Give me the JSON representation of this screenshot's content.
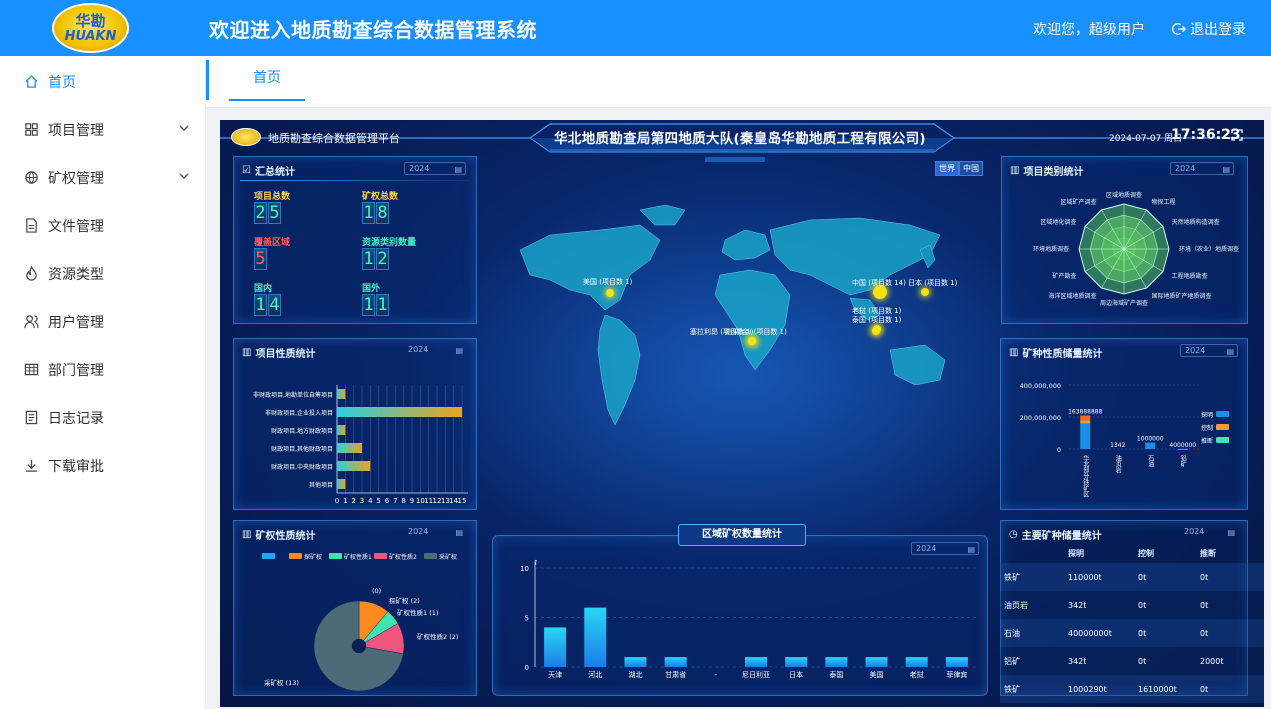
{
  "header": {
    "logo_cn": "华勘",
    "logo_en": "HUAKN",
    "title": "欢迎进入地质勘查综合数据管理系统",
    "welcome": "欢迎您，超级用户",
    "logout": "退出登录"
  },
  "sidebar": {
    "items": [
      {
        "label": "首页",
        "icon": "home-icon",
        "active": true
      },
      {
        "label": "项目管理",
        "icon": "grid-icon",
        "expandable": true
      },
      {
        "label": "矿权管理",
        "icon": "globe-icon",
        "expandable": true
      },
      {
        "label": "文件管理",
        "icon": "file-icon"
      },
      {
        "label": "资源类型",
        "icon": "fire-icon"
      },
      {
        "label": "用户管理",
        "icon": "users-icon"
      },
      {
        "label": "部门管理",
        "icon": "table-icon"
      },
      {
        "label": "日志记录",
        "icon": "log-icon"
      },
      {
        "label": "下载审批",
        "icon": "download-icon"
      }
    ]
  },
  "tabs": [
    {
      "label": "首页"
    }
  ],
  "dashboard": {
    "platform": "地质勘查综合数据管理平台",
    "title": "华北地质勘查局第四地质大队(秦皇岛华勘地质工程有限公司)",
    "date": "2024-07-07 周日",
    "time": "17:36:23",
    "year": "2024",
    "map_buttons": [
      "世界",
      "中国"
    ],
    "summary": {
      "title": "汇总统计",
      "items": [
        {
          "label": "项目总数",
          "value": "25",
          "color": "#ffd54a"
        },
        {
          "label": "矿权总数",
          "value": "18",
          "color": "#ffd54a"
        },
        {
          "label": "覆盖区域",
          "value": "5",
          "color": "#ff5b5b"
        },
        {
          "label": "资源类别数量",
          "value": "12",
          "color": "#3ff0c0"
        },
        {
          "label": "国内",
          "value": "14",
          "color": "#3ff0c0"
        },
        {
          "label": "国外",
          "value": "11",
          "color": "#3ff0c0"
        }
      ]
    },
    "map_points": [
      {
        "label": "美国 (项目数 1)"
      },
      {
        "label": "中国 (项目数 14)"
      },
      {
        "label": "日本 (项目数 1)"
      },
      {
        "label": "老挝 (项目数 1)"
      },
      {
        "label": "泰国 (项目数 1)"
      },
      {
        "label": "塞拉利昂 (项目数 1)"
      },
      {
        "label": "刚果(金) (项目数 1)"
      }
    ],
    "panels": {
      "project_nature": "项目性质统计",
      "project_category": "项目类别统计",
      "mining_reserve": "矿种性质储量统计",
      "mining_right_nature": "矿权性质统计",
      "region_count": "区域矿权数量统计",
      "main_mineral": "主要矿种储量统计"
    },
    "main_mineral_table": {
      "headers": [
        "",
        "探明",
        "控制",
        "推断"
      ],
      "rows": [
        [
          "铁矿",
          "110000t",
          "0t",
          "0t"
        ],
        [
          "油页岩",
          "342t",
          "0t",
          "0t"
        ],
        [
          "石油",
          "40000000t",
          "0t",
          "0t"
        ],
        [
          "铝矿",
          "342t",
          "0t",
          "2000t"
        ],
        [
          "铁矿",
          "1000290t",
          "1610000t",
          "0t"
        ]
      ]
    }
  },
  "chart_data": [
    {
      "type": "bar",
      "title": "项目性质统计",
      "orientation": "horizontal",
      "categories": [
        "非财政项目,地勘单位自筹项目",
        "非财政项目,企业投入项目",
        "财政项目,地方财政项目",
        "财政项目,其他财政项目",
        "财政项目,中央财政项目",
        "其他项目"
      ],
      "values": [
        1,
        15,
        1,
        3,
        4,
        1
      ],
      "xlim": [
        0,
        15
      ],
      "ticks": [
        "0",
        "1",
        "2",
        "3",
        "4",
        "5",
        "6",
        "7",
        "8",
        "9",
        "10",
        "11",
        "12",
        "13",
        "14",
        "15"
      ]
    },
    {
      "type": "bar",
      "title": "区域矿权数量统计",
      "categories": [
        "天津",
        "河北",
        "湖北",
        "甘肃省",
        "-",
        "尼日利亚",
        "日本",
        "泰国",
        "美国",
        "老挝",
        "菲律宾"
      ],
      "values": [
        4,
        6,
        1,
        1,
        0,
        1,
        1,
        1,
        1,
        1,
        1
      ],
      "ylim": [
        0,
        10
      ],
      "yticks": [
        "0",
        "5",
        "10"
      ]
    },
    {
      "type": "pie",
      "title": "矿权性质统计",
      "legend": [
        "探矿权",
        "矿权性质1",
        "矿权性质2",
        "采矿权"
      ],
      "slices": [
        {
          "label": "(0)",
          "value": 0
        },
        {
          "label": "探矿权 (2)",
          "value": 2
        },
        {
          "label": "矿权性质1 (1)",
          "value": 1
        },
        {
          "label": "矿权性质2 (2)",
          "value": 2
        },
        {
          "label": "采矿权 (13)",
          "value": 13
        }
      ],
      "colors": [
        "#1fa8ff",
        "#ff8a1f",
        "#3fe3b0",
        "#f0557f",
        "#4c6a78"
      ]
    },
    {
      "type": "bar",
      "title": "矿种性质储量统计",
      "categories": [
        "华北部分铁矿区",
        "油页岩",
        "石油",
        "铝矿"
      ],
      "series": [
        {
          "name": "推断",
          "values": [
            30000000,
            0,
            0,
            2000
          ]
        },
        {
          "name": "控制",
          "values": [
            20000000,
            0,
            0,
            0
          ]
        },
        {
          "name": "探明",
          "values": [
            160000000,
            0,
            40000000,
            400000
          ]
        }
      ],
      "ylim": [
        0,
        400000000
      ],
      "yticks": [
        "0",
        "200,000,000",
        "400,000,000"
      ],
      "data_labels": [
        "163888888",
        "1342",
        "1000000",
        "4000000"
      ]
    },
    {
      "type": "radar",
      "title": "项目类别统计",
      "axes": [
        "区域地质调查",
        "物探工程",
        "天然地质构造调查",
        "环境（农业）地质调查",
        "工程地质勘查",
        "国际地质矿产地质调查",
        "周边海域矿产调查",
        "海洋区域地质调查",
        "矿产勘查",
        "环境地质调查",
        "区域地化调查",
        "区域矿产调查"
      ]
    }
  ]
}
